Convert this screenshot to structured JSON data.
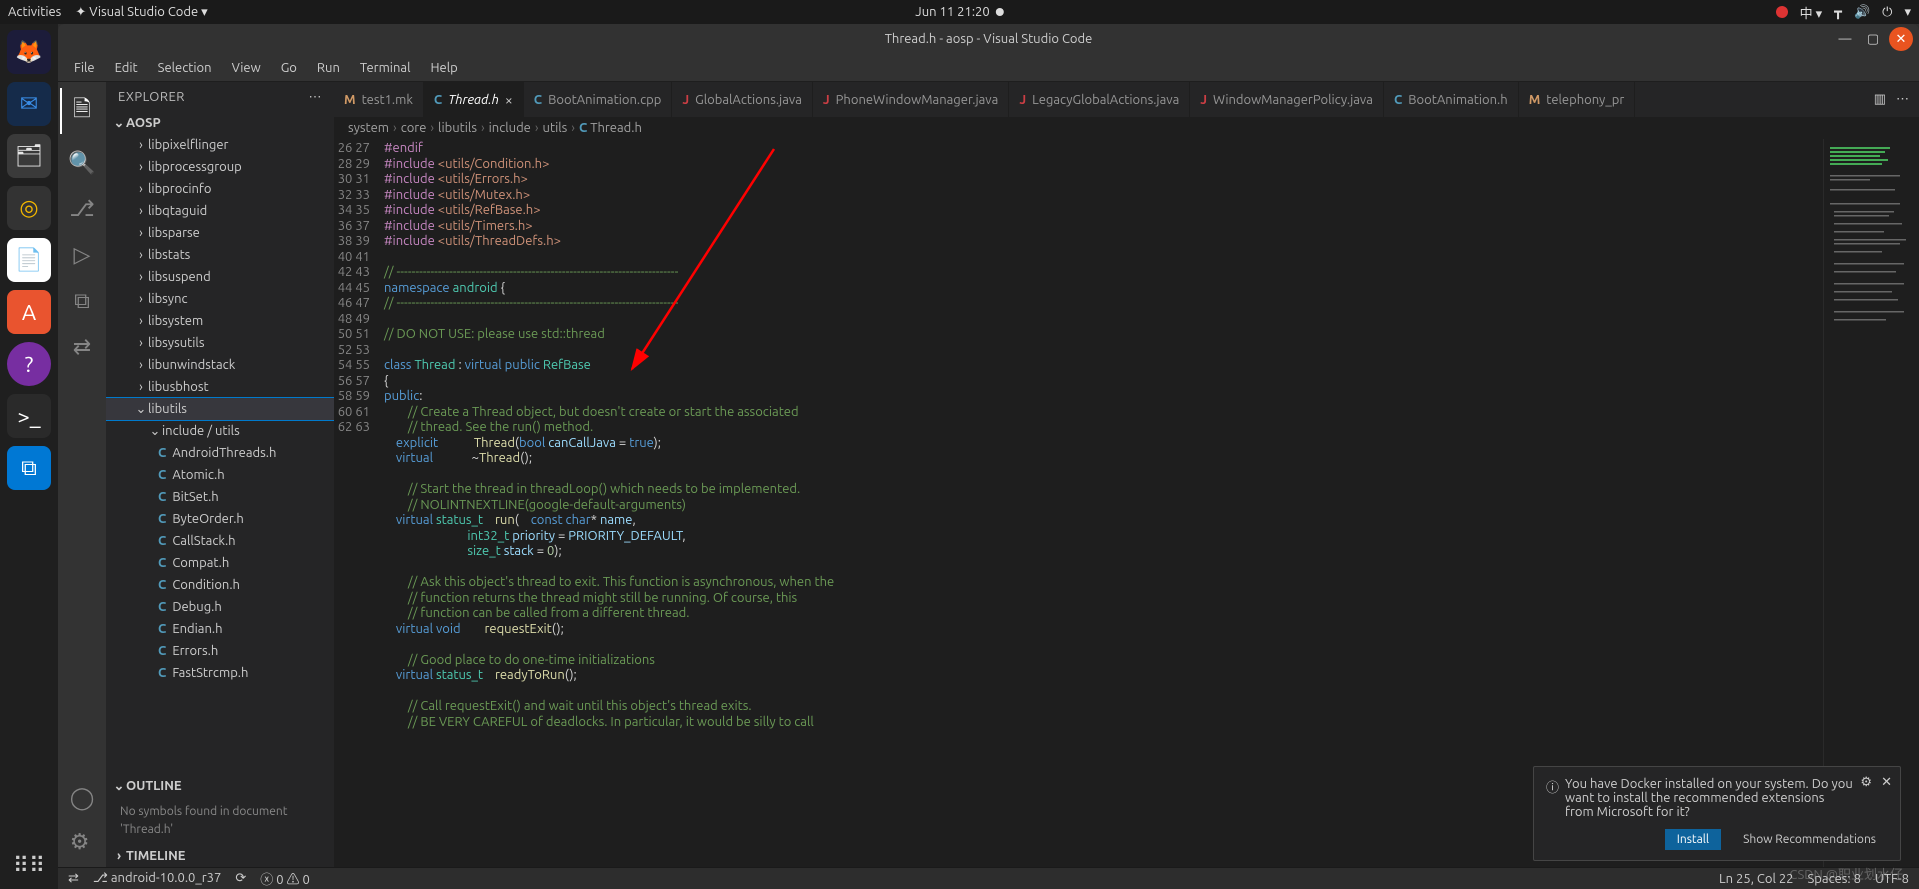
{
  "topbar": {
    "activities": "Activities",
    "app": "Visual Studio Code ▾",
    "datetime": "Jun 11  21:20",
    "lang": "中 ▾"
  },
  "title": "Thread.h - aosp - Visual Studio Code",
  "menus": [
    "File",
    "Edit",
    "Selection",
    "View",
    "Go",
    "Run",
    "Terminal",
    "Help"
  ],
  "sidebar": {
    "title": "EXPLORER",
    "project": "AOSP",
    "folders": [
      "libpixelflinger",
      "libprocessgroup",
      "libprocinfo",
      "libqtaguid",
      "libsparse",
      "libstats",
      "libsuspend",
      "libsync",
      "libsystem",
      "libsysutils",
      "libunwindstack",
      "libusbhost",
      "libutils"
    ],
    "selected": "libutils",
    "subfolder": "include / utils",
    "files": [
      "AndroidThreads.h",
      "Atomic.h",
      "BitSet.h",
      "ByteOrder.h",
      "CallStack.h",
      "Compat.h",
      "Condition.h",
      "Debug.h",
      "Endian.h",
      "Errors.h",
      "FastStrcmp.h"
    ],
    "outline_title": "OUTLINE",
    "outline_msg": "No symbols found in document 'Thread.h'",
    "timeline_title": "TIMELINE"
  },
  "tabs": [
    {
      "icon": "M",
      "cls": "m",
      "label": "test1.mk"
    },
    {
      "icon": "C",
      "cls": "c",
      "label": "Thread.h",
      "active": true,
      "dirty": false,
      "close": true
    },
    {
      "icon": "C",
      "cls": "c",
      "label": "BootAnimation.cpp"
    },
    {
      "icon": "J",
      "cls": "j",
      "label": "GlobalActions.java"
    },
    {
      "icon": "J",
      "cls": "j",
      "label": "PhoneWindowManager.java"
    },
    {
      "icon": "J",
      "cls": "j",
      "label": "LegacyGlobalActions.java"
    },
    {
      "icon": "J",
      "cls": "j",
      "label": "WindowManagerPolicy.java"
    },
    {
      "icon": "C",
      "cls": "c",
      "label": "BootAnimation.h"
    },
    {
      "icon": "M",
      "cls": "m",
      "label": "telephony_pr"
    }
  ],
  "crumbs": [
    "system",
    "core",
    "libutils",
    "include",
    "utils",
    "Thread.h"
  ],
  "crumb_last_icon": "C",
  "code": {
    "start": 26,
    "lines": [
      {
        "t": "pp",
        "txt": "#endif"
      },
      {
        "t": "inc",
        "d": "#include",
        "p": "<utils/Condition.h>"
      },
      {
        "t": "inc",
        "d": "#include",
        "p": "<utils/Errors.h>"
      },
      {
        "t": "inc",
        "d": "#include",
        "p": "<utils/Mutex.h>"
      },
      {
        "t": "inc",
        "d": "#include",
        "p": "<utils/RefBase.h>"
      },
      {
        "t": "inc",
        "d": "#include",
        "p": "<utils/Timers.h>"
      },
      {
        "t": "inc",
        "d": "#include",
        "p": "<utils/ThreadDefs.h>"
      },
      {
        "t": "blank"
      },
      {
        "t": "cm",
        "txt": "// ---------------------------------------------------------------------------"
      },
      {
        "t": "ns",
        "txt": "namespace android {"
      },
      {
        "t": "cm",
        "txt": "// ---------------------------------------------------------------------------"
      },
      {
        "t": "blank"
      },
      {
        "t": "cm",
        "txt": "// DO NOT USE: please use std::thread"
      },
      {
        "t": "blank"
      },
      {
        "t": "cls",
        "txt": "class Thread : virtual public RefBase"
      },
      {
        "t": "plain",
        "txt": "{"
      },
      {
        "t": "pub",
        "txt": "public:"
      },
      {
        "t": "cm",
        "pad": 8,
        "txt": "// Create a Thread object, but doesn't create or start the associated"
      },
      {
        "t": "cm",
        "pad": 8,
        "txt": "// thread. See the run() method."
      },
      {
        "t": "ctor"
      },
      {
        "t": "dtor"
      },
      {
        "t": "blank"
      },
      {
        "t": "cm",
        "pad": 8,
        "txt": "// Start the thread in threadLoop() which needs to be implemented."
      },
      {
        "t": "cm",
        "pad": 8,
        "txt": "// NOLINTNEXTLINE(google-default-arguments)"
      },
      {
        "t": "run1"
      },
      {
        "t": "run2"
      },
      {
        "t": "run3"
      },
      {
        "t": "blank"
      },
      {
        "t": "cm",
        "pad": 8,
        "txt": "// Ask this object's thread to exit. This function is asynchronous, when the"
      },
      {
        "t": "cm",
        "pad": 8,
        "txt": "// function returns the thread might still be running. Of course, this"
      },
      {
        "t": "cm",
        "pad": 8,
        "txt": "// function can be called from a different thread."
      },
      {
        "t": "req"
      },
      {
        "t": "blank"
      },
      {
        "t": "cm",
        "pad": 8,
        "txt": "// Good place to do one-time initializations"
      },
      {
        "t": "ready"
      },
      {
        "t": "blank"
      },
      {
        "t": "cm",
        "pad": 8,
        "txt": "// Call requestExit() and wait until this object's thread exits."
      },
      {
        "t": "cm",
        "pad": 8,
        "txt": "// BE VERY CAREFUL of deadlocks. In particular, it would be silly to call"
      }
    ]
  },
  "notif": {
    "msg": "You have Docker installed on your system. Do you want to install the recommended extensions from Microsoft for it?",
    "install": "Install",
    "show": "Show Recommendations"
  },
  "status": {
    "branch": "android-10.0.0_r37",
    "errors": "0",
    "warnings": "0",
    "ln": "Ln 25, Col 22",
    "spaces": "Spaces: 8",
    "enc": "UTF-8"
  },
  "watermark": "CSDN @职业划水仔"
}
